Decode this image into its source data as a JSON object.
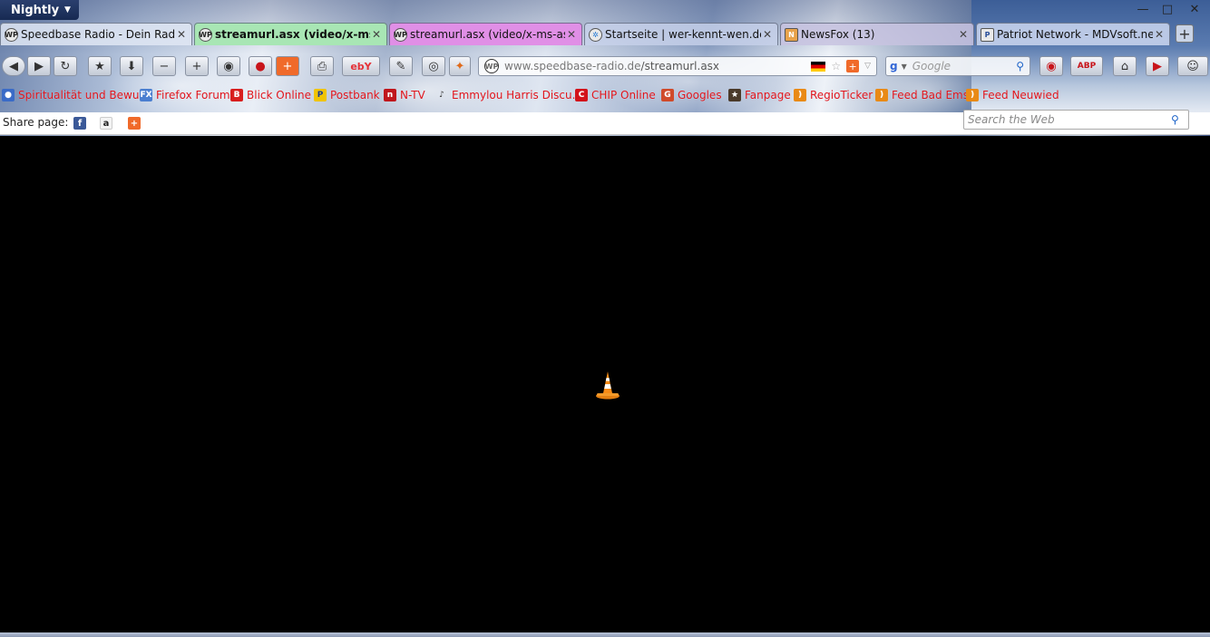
{
  "app_menu": {
    "label": "Nightly"
  },
  "window_controls": {
    "minimize": "—",
    "maximize": "□",
    "close": "✕"
  },
  "tabs": [
    {
      "label": "Speedbase Radio - Dein Radio ...",
      "icon_text": "WP",
      "active": false
    },
    {
      "label": "streamurl.asx (video/x-ms-a...",
      "icon_text": "WP",
      "active": true
    },
    {
      "label": "streamurl.asx (video/x-ms-asf-...",
      "icon_text": "WP",
      "active": false
    },
    {
      "label": "Startseite | wer-kennt-wen.de",
      "icon_text": "✲",
      "active": false
    },
    {
      "label": "NewsFox (13)",
      "icon_text": "N",
      "active": false
    },
    {
      "label": "Patriot Network - MDVsoft.net ...",
      "icon_text": "P",
      "active": false
    }
  ],
  "new_tab_label": "+",
  "url": {
    "domain": "www.speedbase-radio.de",
    "path": "/streamurl.asx"
  },
  "search": {
    "placeholder": "Google"
  },
  "bookmarks": [
    {
      "label": "Spiritualität und Bewu...",
      "icon": "person-icon",
      "color": "#3a6bc7"
    },
    {
      "label": "Firefox Forum",
      "icon": "fx-icon",
      "color": "#4b7fd0"
    },
    {
      "label": "Blick Online",
      "icon": "blick-icon",
      "color": "#d81e1e"
    },
    {
      "label": "Postbank",
      "icon": "postbank-icon",
      "color": "#f0c400"
    },
    {
      "label": "N-TV",
      "icon": "ntv-icon",
      "color": "#c0161c"
    },
    {
      "label": "Emmylou Harris Discu...",
      "icon": "music-icon",
      "color": "#333333"
    },
    {
      "label": "CHIP Online",
      "icon": "chip-icon",
      "color": "#d3121a"
    },
    {
      "label": "Googles",
      "icon": "google-icon",
      "color": "#d04a2a"
    },
    {
      "label": "Fanpage",
      "icon": "fan-icon",
      "color": "#4a3a2a"
    },
    {
      "label": "RegioTicker",
      "icon": "rss-icon",
      "color": "#e98a16"
    },
    {
      "label": "Feed Bad Ems",
      "icon": "rss-icon",
      "color": "#e98a16"
    },
    {
      "label": "Feed Neuwied",
      "icon": "rss-icon",
      "color": "#e98a16"
    }
  ],
  "share": {
    "label": "Share page:"
  },
  "web_search": {
    "placeholder": "Search the Web"
  }
}
